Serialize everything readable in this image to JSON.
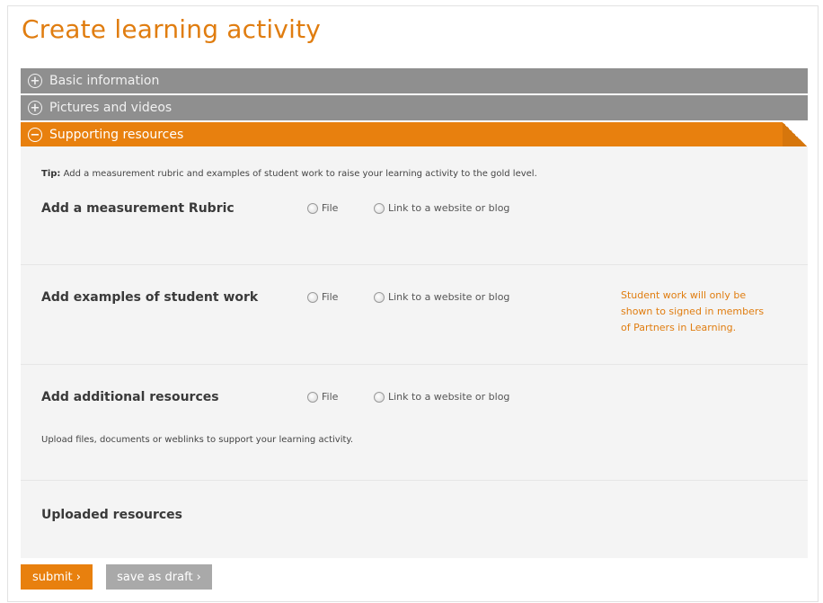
{
  "page": {
    "title": "Create learning activity"
  },
  "accordion": {
    "sections": [
      {
        "label": "Basic information",
        "state": "collapsed",
        "icon": "plus-circle-icon"
      },
      {
        "label": "Pictures and videos",
        "state": "collapsed",
        "icon": "plus-circle-icon"
      },
      {
        "label": "Supporting resources",
        "state": "expanded",
        "icon": "minus-circle-icon"
      }
    ]
  },
  "supporting": {
    "tip_prefix": "Tip:",
    "tip_text": "Add a measurement rubric and examples of student work to raise your learning activity to the gold level.",
    "rows": [
      {
        "label": "Add a measurement Rubric",
        "option_file": "File",
        "option_link": "Link to a website or blog"
      },
      {
        "label": "Add examples of student work",
        "option_file": "File",
        "option_link": "Link to a website or blog"
      },
      {
        "label": "Add additional resources",
        "option_file": "File",
        "option_link": "Link to a website or blog"
      }
    ],
    "student_work_note": "Student work will only be shown to signed in members of Partners in Learning.",
    "additional_help": "Upload files, documents or weblinks to support your learning activity.",
    "uploaded_label": "Uploaded resources"
  },
  "actions": {
    "submit_label": "submit ›",
    "draft_label": "save as draft ›"
  },
  "colors": {
    "accent": "#e8800e",
    "collapsed_header": "#8f8f8f",
    "panel_bg": "#f4f4f4",
    "draft_button": "#a9a9a9"
  }
}
